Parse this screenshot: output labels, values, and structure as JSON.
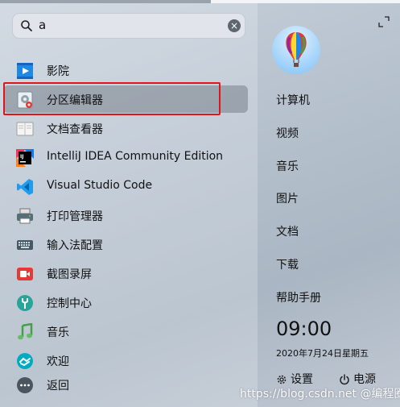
{
  "search": {
    "query": "a",
    "clear_label": "×"
  },
  "results": [
    {
      "label": "影院",
      "icon": "video-player-icon"
    },
    {
      "label": "分区编辑器",
      "icon": "partition-editor-icon",
      "selected": true
    },
    {
      "label": "文档查看器",
      "icon": "document-viewer-icon"
    },
    {
      "label": "IntelliJ IDEA Community Edition",
      "icon": "intellij-idea-icon"
    },
    {
      "label": "Visual Studio Code",
      "icon": "vscode-icon"
    },
    {
      "label": "打印管理器",
      "icon": "printer-icon"
    },
    {
      "label": "输入法配置",
      "icon": "keyboard-icon"
    },
    {
      "label": "截图录屏",
      "icon": "screen-recorder-icon"
    },
    {
      "label": "控制中心",
      "icon": "control-center-icon"
    },
    {
      "label": "音乐",
      "icon": "music-icon"
    },
    {
      "label": "欢迎",
      "icon": "welcome-icon"
    },
    {
      "label": "返回",
      "icon": "more-icon"
    }
  ],
  "sidebar": {
    "links": [
      "计算机",
      "视频",
      "音乐",
      "图片",
      "文档",
      "下载",
      "帮助手册"
    ],
    "time": "09:00",
    "date": "2020年7月24日星期五",
    "settings_label": "设置",
    "power_label": "电源"
  },
  "watermark": "https://blog.csdn.net @编程圈"
}
